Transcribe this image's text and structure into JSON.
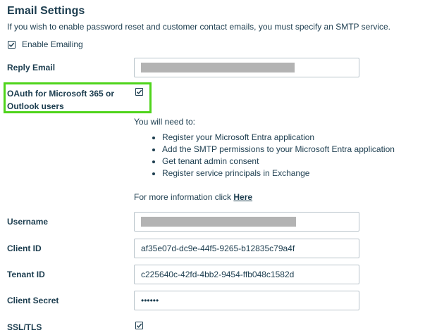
{
  "section": {
    "title": "Email Settings",
    "description": "If you wish to enable password reset and customer contact emails, you must specify an SMTP service."
  },
  "enable_emailing": {
    "label": "Enable Emailing",
    "checked": true
  },
  "reply_email": {
    "label": "Reply Email",
    "value_redacted": true
  },
  "oauth": {
    "label": "OAuth for Microsoft 365 or Outlook users",
    "checked": true,
    "highlight_color": "#4fd41b"
  },
  "requirements": {
    "intro": "You will need to:",
    "items": [
      "Register your Microsoft Entra application",
      "Add the SMTP permissions to your Microsoft Entra application",
      "Get tenant admin consent",
      "Register service principals in Exchange"
    ],
    "more_info_text": "For more information click ",
    "more_info_link": "Here"
  },
  "username": {
    "label": "Username",
    "value_redacted": true
  },
  "client_id": {
    "label": "Client ID",
    "value": "af35e07d-dc9e-44f5-9265-b12835c79a4f"
  },
  "tenant_id": {
    "label": "Tenant ID",
    "value": "c225640c-42fd-4bb2-9454-ffb048c1582d"
  },
  "client_secret": {
    "label": "Client Secret",
    "value": "••••••"
  },
  "ssl_tls": {
    "label": "SSL/TLS",
    "checked": true
  },
  "colors": {
    "text": "#1c3d4f",
    "input_border": "#b9c4cb",
    "redaction": "#b3b3b3"
  }
}
